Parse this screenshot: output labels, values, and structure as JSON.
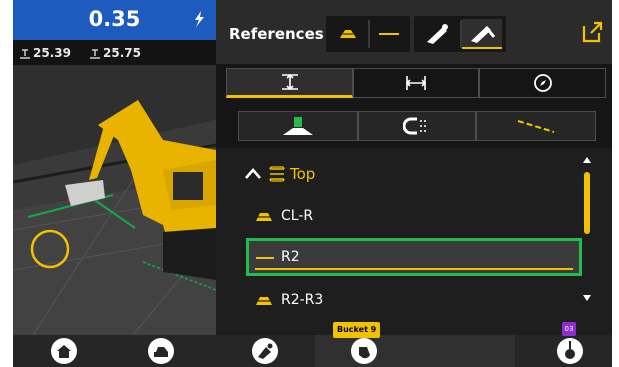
{
  "guidance": {
    "value": "0.35"
  },
  "elevations": [
    {
      "icon": "elevation-left-icon",
      "value": "25.39"
    },
    {
      "icon": "elevation-right-icon",
      "value": "25.75"
    }
  ],
  "panel": {
    "title": "References"
  },
  "header_buttons": [
    {
      "icon": "reference-surface-icon",
      "selected": false
    },
    {
      "icon": "reference-line-icon",
      "selected": false
    },
    {
      "icon": "boom-icon",
      "selected": false
    },
    {
      "icon": "boom-stick-icon",
      "selected": true
    }
  ],
  "mode_tabs": [
    {
      "icon": "vertical-distance-icon",
      "selected": true
    },
    {
      "icon": "horizontal-distance-icon",
      "selected": false
    },
    {
      "icon": "compass-icon",
      "selected": false
    }
  ],
  "target_tabs": [
    {
      "icon": "surface-target-icon"
    },
    {
      "icon": "magnet-line-icon"
    },
    {
      "icon": "dashed-line-icon"
    }
  ],
  "layer": {
    "name": "Top",
    "expanded": true
  },
  "references": [
    {
      "name": "CL-R",
      "icon": "surface-icon",
      "selected": false
    },
    {
      "name": "R2",
      "icon": "line-icon",
      "selected": true
    },
    {
      "name": "R2-R3",
      "icon": "surface-icon",
      "selected": false
    }
  ],
  "bottom_bar": {
    "bucket_label": "Bucket 9",
    "badge": "03"
  },
  "colors": {
    "accent": "#f2c200",
    "selection": "#1fbd4d",
    "guidance_bg": "#1d5bbf",
    "bucket_tag": "#f2c200",
    "badge": "#8e2bd3"
  }
}
